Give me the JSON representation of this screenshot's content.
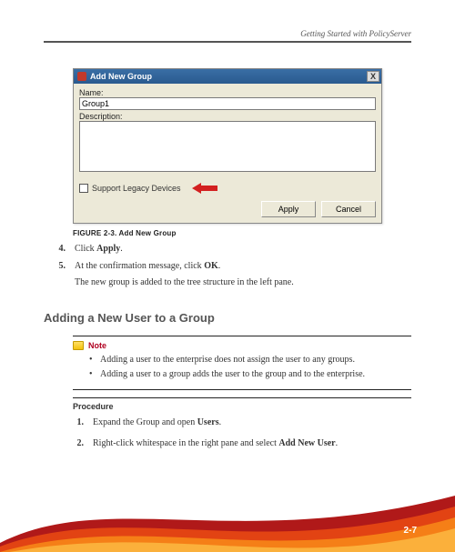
{
  "running_head": "Getting Started with PolicyServer",
  "dialog": {
    "title": "Add New Group",
    "close_glyph": "X",
    "name_label": "Name:",
    "name_value": "Group1",
    "description_label": "Description:",
    "description_value": "",
    "legacy_label": "Support Legacy Devices",
    "apply_label": "Apply",
    "cancel_label": "Cancel"
  },
  "figure_caption": "FIGURE 2-3. Add New Group",
  "steps_a": {
    "s4_num": "4.",
    "s4_pre": "Click ",
    "s4_bold": "Apply",
    "s4_post": ".",
    "s5_num": "5.",
    "s5_pre": "At the confirmation message, click ",
    "s5_bold": "OK",
    "s5_post": "."
  },
  "result_line": "The new group is added to the tree structure in the left pane.",
  "heading": "Adding a New User to a Group",
  "note": {
    "title": "Note",
    "b1": "Adding a user to the enterprise does not assign the user to any groups.",
    "b2": "Adding a user to a group adds the user to the group and to the enterprise."
  },
  "procedure_heading": "Procedure",
  "steps_b": {
    "s1_num": "1.",
    "s1_pre": "Expand the Group and open ",
    "s1_bold": "Users",
    "s1_post": ".",
    "s2_num": "2.",
    "s2_pre": "Right-click whitespace in the right pane and select ",
    "s2_bold": "Add New User",
    "s2_post": "."
  },
  "page_number": "2-7"
}
